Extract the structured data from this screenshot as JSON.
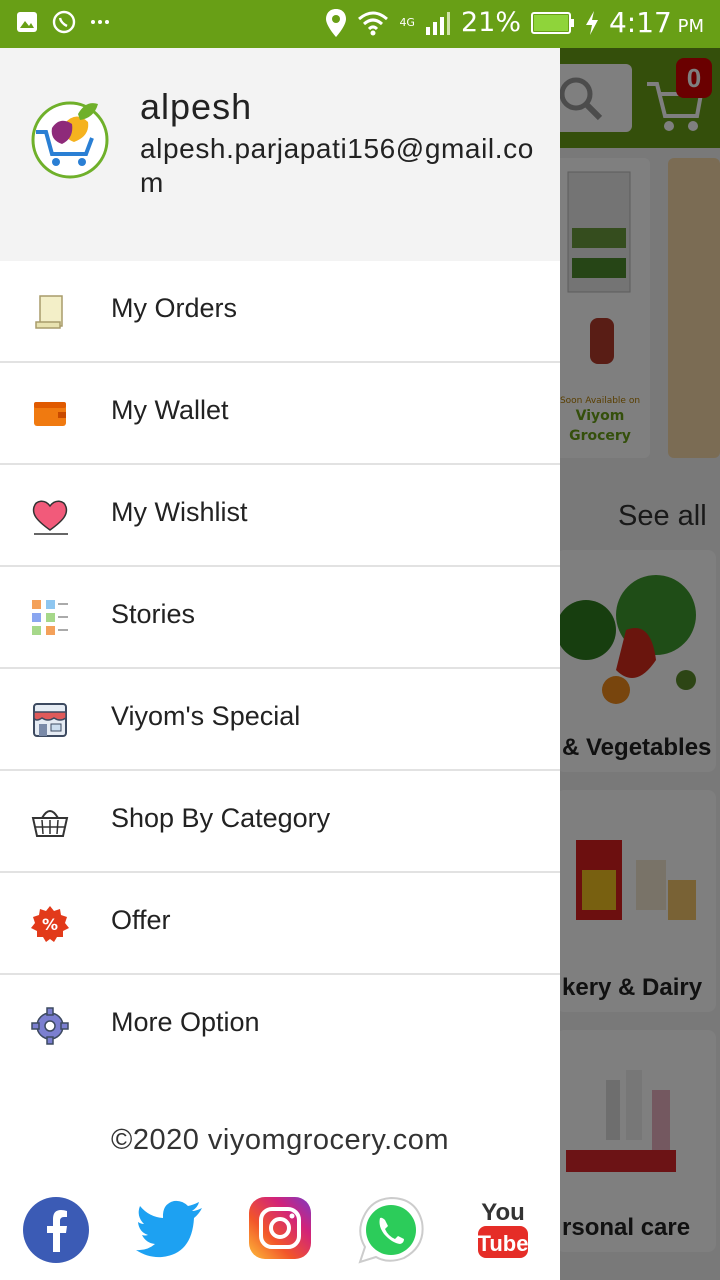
{
  "status_bar": {
    "battery": "21%",
    "time": "4:17",
    "ampm": "PM",
    "network": "4G",
    "colors": {
      "bar": "#689f16"
    }
  },
  "background": {
    "cart_count": "0",
    "see_all": "See all",
    "cards": [
      {
        "label": "& Vegetables"
      },
      {
        "label": "kery & Dairy"
      },
      {
        "label": "rsonal care"
      }
    ]
  },
  "drawer": {
    "user": {
      "name": "alpesh",
      "email": "alpesh.parjapati156@gmail.com"
    },
    "menu": [
      {
        "label": "My Orders",
        "icon": "orders-icon"
      },
      {
        "label": "My Wallet",
        "icon": "wallet-icon"
      },
      {
        "label": "My Wishlist",
        "icon": "heart-icon"
      },
      {
        "label": "Stories",
        "icon": "stories-grid-icon"
      },
      {
        "label": "Viyom's Special",
        "icon": "store-icon"
      },
      {
        "label": "Shop By Category",
        "icon": "basket-icon"
      },
      {
        "label": "Offer",
        "icon": "percent-badge-icon"
      },
      {
        "label": "More Option",
        "icon": "gear-icon"
      }
    ],
    "copyright": "©2020 viyomgrocery.com",
    "social": [
      "facebook-icon",
      "twitter-icon",
      "instagram-icon",
      "whatsapp-icon",
      "youtube-icon"
    ]
  }
}
